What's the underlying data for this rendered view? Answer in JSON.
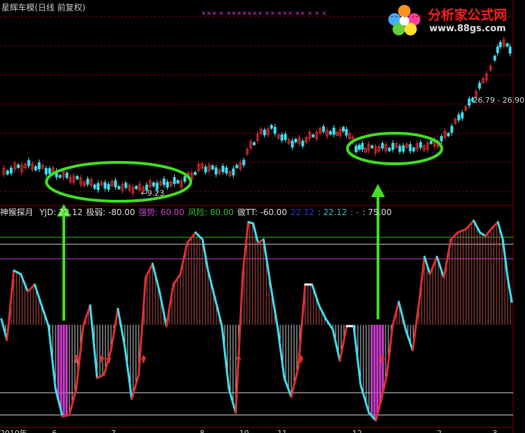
{
  "window": {
    "title": "星辉车模(日线 前复权)"
  },
  "logo": {
    "name": "分析家公式网",
    "url": "www.88gs.com"
  },
  "price_panel": {
    "high_range_label": "26.79 - 26.90",
    "low_marker_label": "←9.23",
    "top_markers": "××× × ××××××× ×× ××× ×× × × ×"
  },
  "indicator": {
    "name": "神猴探月",
    "items": [
      {
        "text": "YJD: 22.12",
        "color": "#e0e0e0"
      },
      {
        "text": "极弱: -80.00",
        "color": "#e0e0e0"
      },
      {
        "text": "强势: 60.00",
        "color": "#d040d0"
      },
      {
        "text": "风险: 80.00",
        "color": "#30c030"
      },
      {
        "text": "做TT: -60.00",
        "color": "#e0e0e0"
      },
      {
        "text": "22.12",
        "color": "#3030e0"
      },
      {
        "text": ": 22.12",
        "color": "#30c0c0"
      },
      {
        "text": ": -",
        "color": "#d040d0"
      },
      {
        "text": ": 75.00",
        "color": "#e0e0e0"
      }
    ]
  },
  "x_axis": {
    "labels": [
      "2010年",
      "6",
      "7",
      "8",
      "10",
      "11",
      "12",
      "2",
      "3"
    ]
  },
  "colors": {
    "up": "#e03030",
    "down": "#40e0f0",
    "neutral": "#ffffff",
    "grid": "#8b0000",
    "annotation": "#40e020",
    "strong": "#d040d0"
  }
}
